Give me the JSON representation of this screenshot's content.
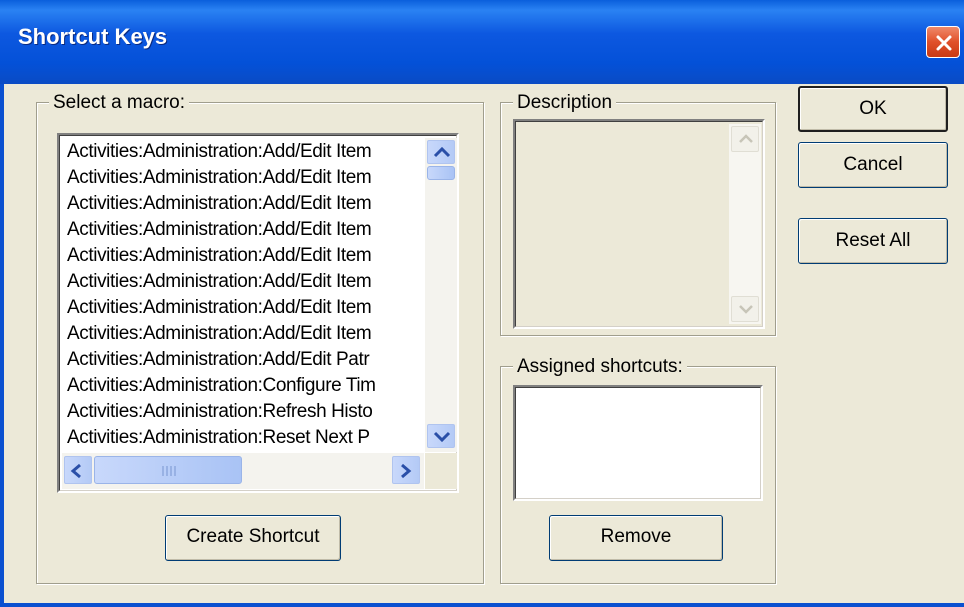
{
  "window": {
    "title": "Shortcut Keys",
    "close_icon": "close-icon"
  },
  "macro_group": {
    "legend": "Select a macro:",
    "items": [
      "Activities:Administration:Add/Edit Item",
      "Activities:Administration:Add/Edit Item",
      "Activities:Administration:Add/Edit Item",
      "Activities:Administration:Add/Edit Item",
      "Activities:Administration:Add/Edit Item",
      "Activities:Administration:Add/Edit Item",
      "Activities:Administration:Add/Edit Item",
      "Activities:Administration:Add/Edit Item",
      "Activities:Administration:Add/Edit Patr",
      "Activities:Administration:Configure Tim",
      "Activities:Administration:Refresh Histo",
      "Activities:Administration:Reset Next P"
    ],
    "create_button": "Create Shortcut"
  },
  "description_group": {
    "legend": "Description",
    "text": ""
  },
  "assigned_group": {
    "legend": "Assigned shortcuts:",
    "items": [],
    "remove_button": "Remove"
  },
  "buttons": {
    "ok": "OK",
    "cancel": "Cancel",
    "reset_all": "Reset All"
  },
  "colors": {
    "titlebar": "#0451d8",
    "dialog_bg": "#ece9d8",
    "close_button": "#e0502a",
    "scrollbar": "#b4caf6"
  }
}
